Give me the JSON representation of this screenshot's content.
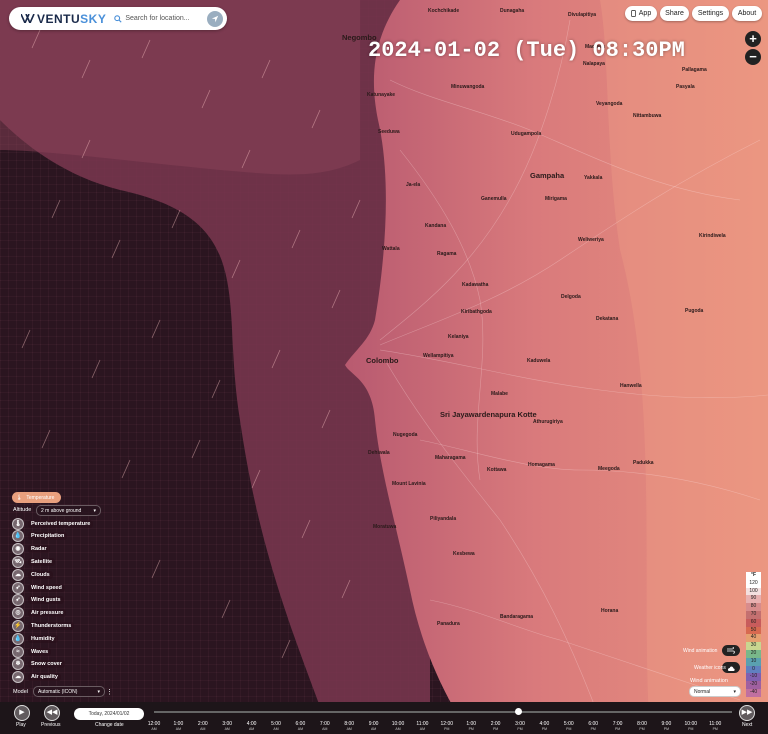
{
  "brand": {
    "name_left": "VENTU",
    "name_right": "SKY"
  },
  "search": {
    "placeholder": "Search for location..."
  },
  "top_buttons": {
    "app": "App",
    "share": "Share",
    "settings": "Settings",
    "about": "About"
  },
  "datetime": "2024-01-02 (Tue) 08:30PM",
  "zoom": {
    "in": "+",
    "out": "−"
  },
  "places": [
    "Negombo",
    "Kochchikade",
    "Dunagaha",
    "Divulapitiya",
    "Maduwa",
    "Nalapaya",
    "Pallagama",
    "Pasyala",
    "Minuwangoda",
    "Veyangoda",
    "Nittambuwa",
    "Katunayake",
    "Seeduwa",
    "Udugampola",
    "Ja-ela",
    "Gampaha",
    "Yakkala",
    "Kandana",
    "Ganemulla",
    "Mirigama",
    "Wattala",
    "Ragama",
    "Kiribathgoda",
    "Kadawatha",
    "Weliweriya",
    "Kirindiwela",
    "Delgoda",
    "Dekatana",
    "Pugoda",
    "Kelaniya",
    "Wellampitiya",
    "Colombo",
    "Kaduwela",
    "Malabe",
    "Hanwella",
    "Sri Jayawardenapura Kotte",
    "Athurugiriya",
    "Dehiwala",
    "Nugegoda",
    "Maharagama",
    "Homagama",
    "Padukka",
    "Kottawa",
    "Moratuwa",
    "Piliyandala",
    "Kesbewa",
    "Bandaragama",
    "Horana",
    "Panadura",
    "Meegoda",
    "Mount Lavinia"
  ],
  "layers": {
    "active": "Temperature",
    "altitude_label": "Altitude",
    "altitude_value": "2 m above ground",
    "items": [
      "Perceived temperature",
      "Precipitation",
      "Radar",
      "Satellite",
      "Clouds",
      "Wind speed",
      "Wind gusts",
      "Air pressure",
      "Thunderstorms",
      "Humidity",
      "Waves",
      "Snow cover",
      "Air quality"
    ],
    "model_label": "Model",
    "model_value": "Automatic (ICON)"
  },
  "legend": {
    "unit": "°F",
    "values": [
      "120",
      "100",
      "90",
      "80",
      "70",
      "60",
      "50",
      "40",
      "30",
      "20",
      "10",
      "0",
      "-10",
      "-20",
      "-40"
    ],
    "colors": [
      "#ffffff",
      "#f4e0e0",
      "#e8b0b0",
      "#d88c8c",
      "#c47070",
      "#c85c5c",
      "#d86a50",
      "#e6a070",
      "#c9d690",
      "#79b88a",
      "#5aa0b0",
      "#6080c0",
      "#8060b0",
      "#a060a0",
      "#c070a0"
    ]
  },
  "overlays": {
    "show_wind": "Wind animation",
    "show_cities": "Weather icons",
    "wind_label": "Wind animation",
    "wind_value": "Normal"
  },
  "timeline": {
    "play": "Play",
    "previous": "Previous",
    "next": "Next",
    "today": "Today, 2024/01/02",
    "change_date": "Change date",
    "hours": [
      "12:00",
      "1:00",
      "2:00",
      "3:00",
      "4:00",
      "5:00",
      "6:00",
      "7:00",
      "8:00",
      "9:00",
      "10:00",
      "11:00",
      "12:00",
      "1:00",
      "2:00",
      "3:00",
      "4:00",
      "5:00",
      "6:00",
      "7:00",
      "8:00",
      "9:00",
      "10:00",
      "11:00"
    ],
    "ampm": [
      "AM",
      "AM",
      "AM",
      "AM",
      "AM",
      "AM",
      "AM",
      "AM",
      "AM",
      "AM",
      "AM",
      "AM",
      "PM",
      "PM",
      "PM",
      "PM",
      "PM",
      "PM",
      "PM",
      "PM",
      "PM",
      "PM",
      "PM",
      "PM"
    ],
    "progress": 0.63
  }
}
